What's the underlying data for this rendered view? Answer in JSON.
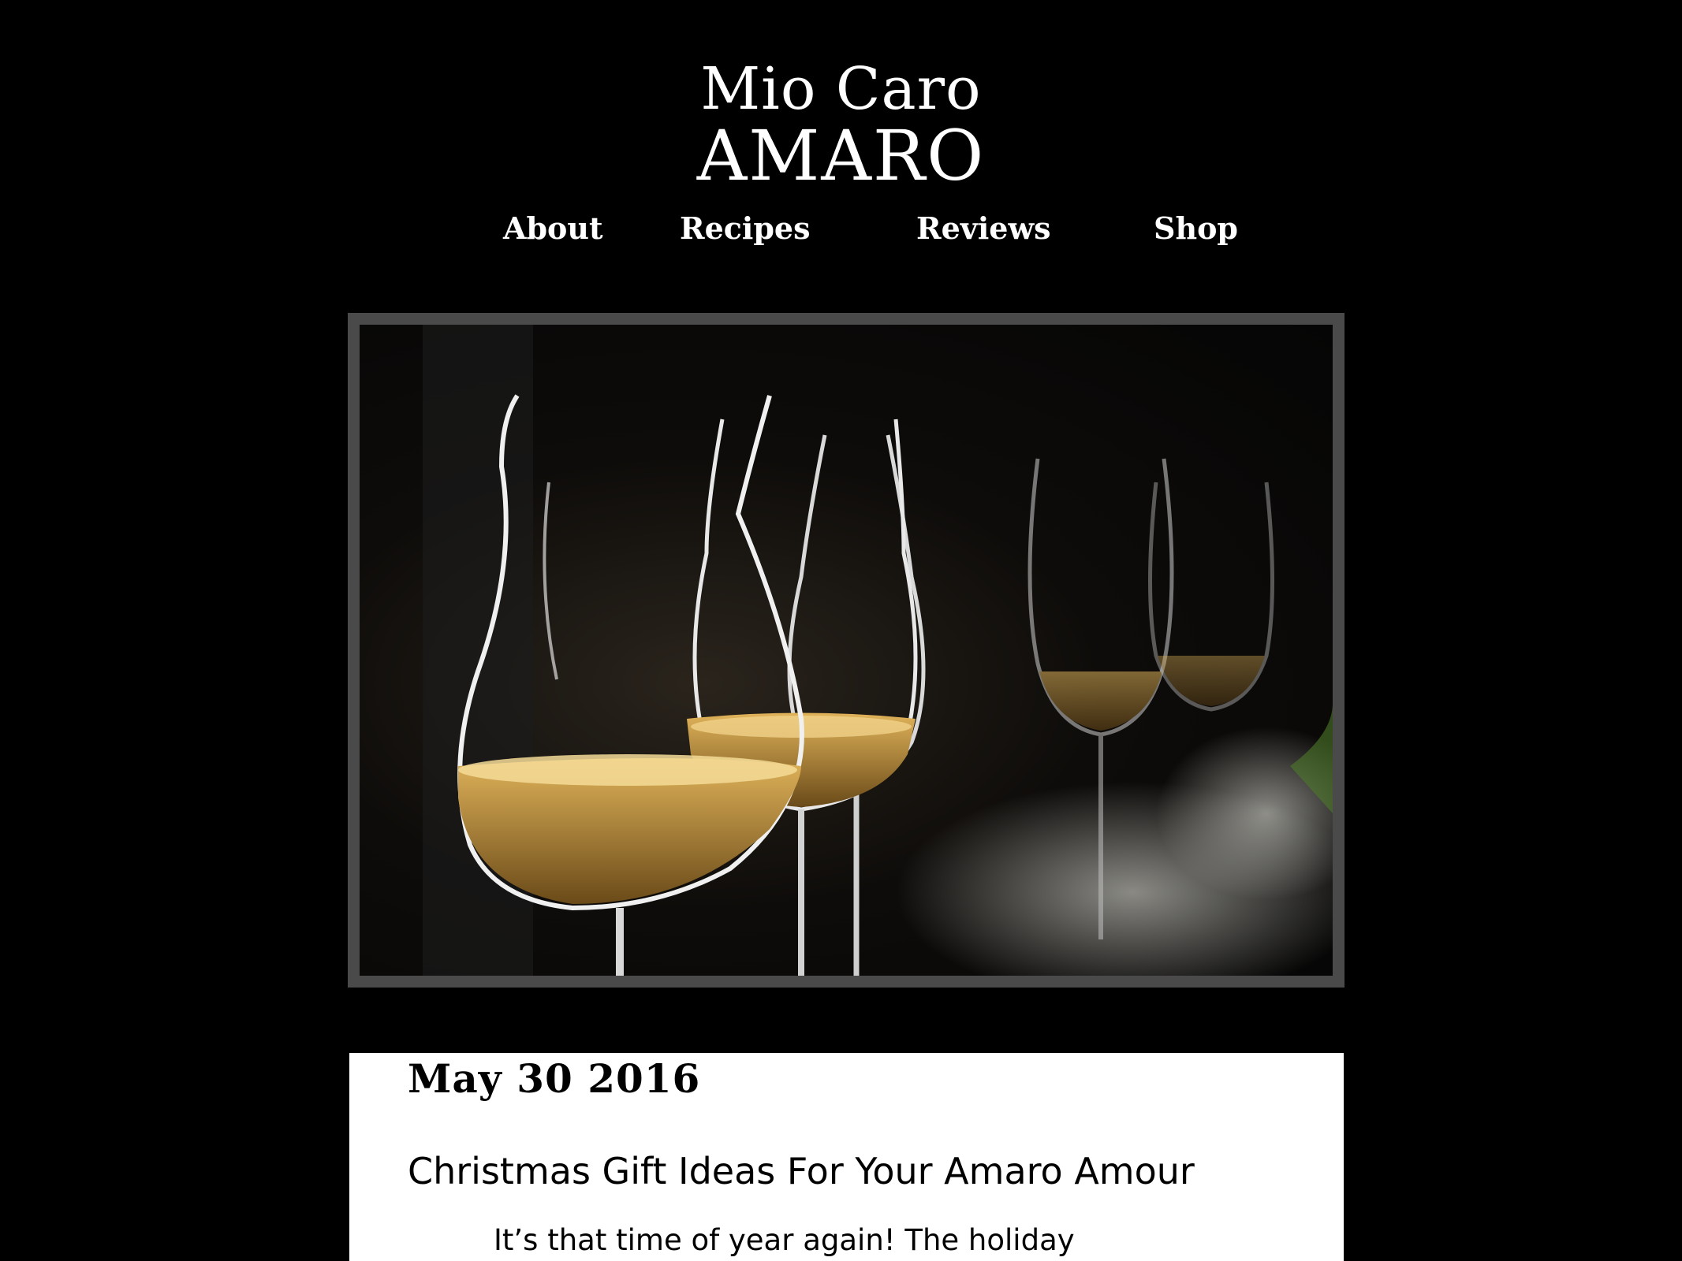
{
  "site": {
    "title_line1": "Mio Caro",
    "title_line2": "AMARO"
  },
  "nav": {
    "items": [
      {
        "label": "About"
      },
      {
        "label": "Recipes"
      },
      {
        "label": "Reviews"
      },
      {
        "label": "Shop"
      }
    ]
  },
  "hero": {
    "subject": "amber liquor in tulip glasses on dark background"
  },
  "post": {
    "date": "May 30 2016",
    "title": "Christmas Gift Ideas For Your Amaro Amour",
    "excerpt": "It’s that time of year again! The holiday"
  },
  "colors": {
    "background": "#000000",
    "text_light": "#ffffff",
    "frame": "#4a4a4a",
    "card": "#ffffff",
    "liquor": "#b8862a"
  }
}
